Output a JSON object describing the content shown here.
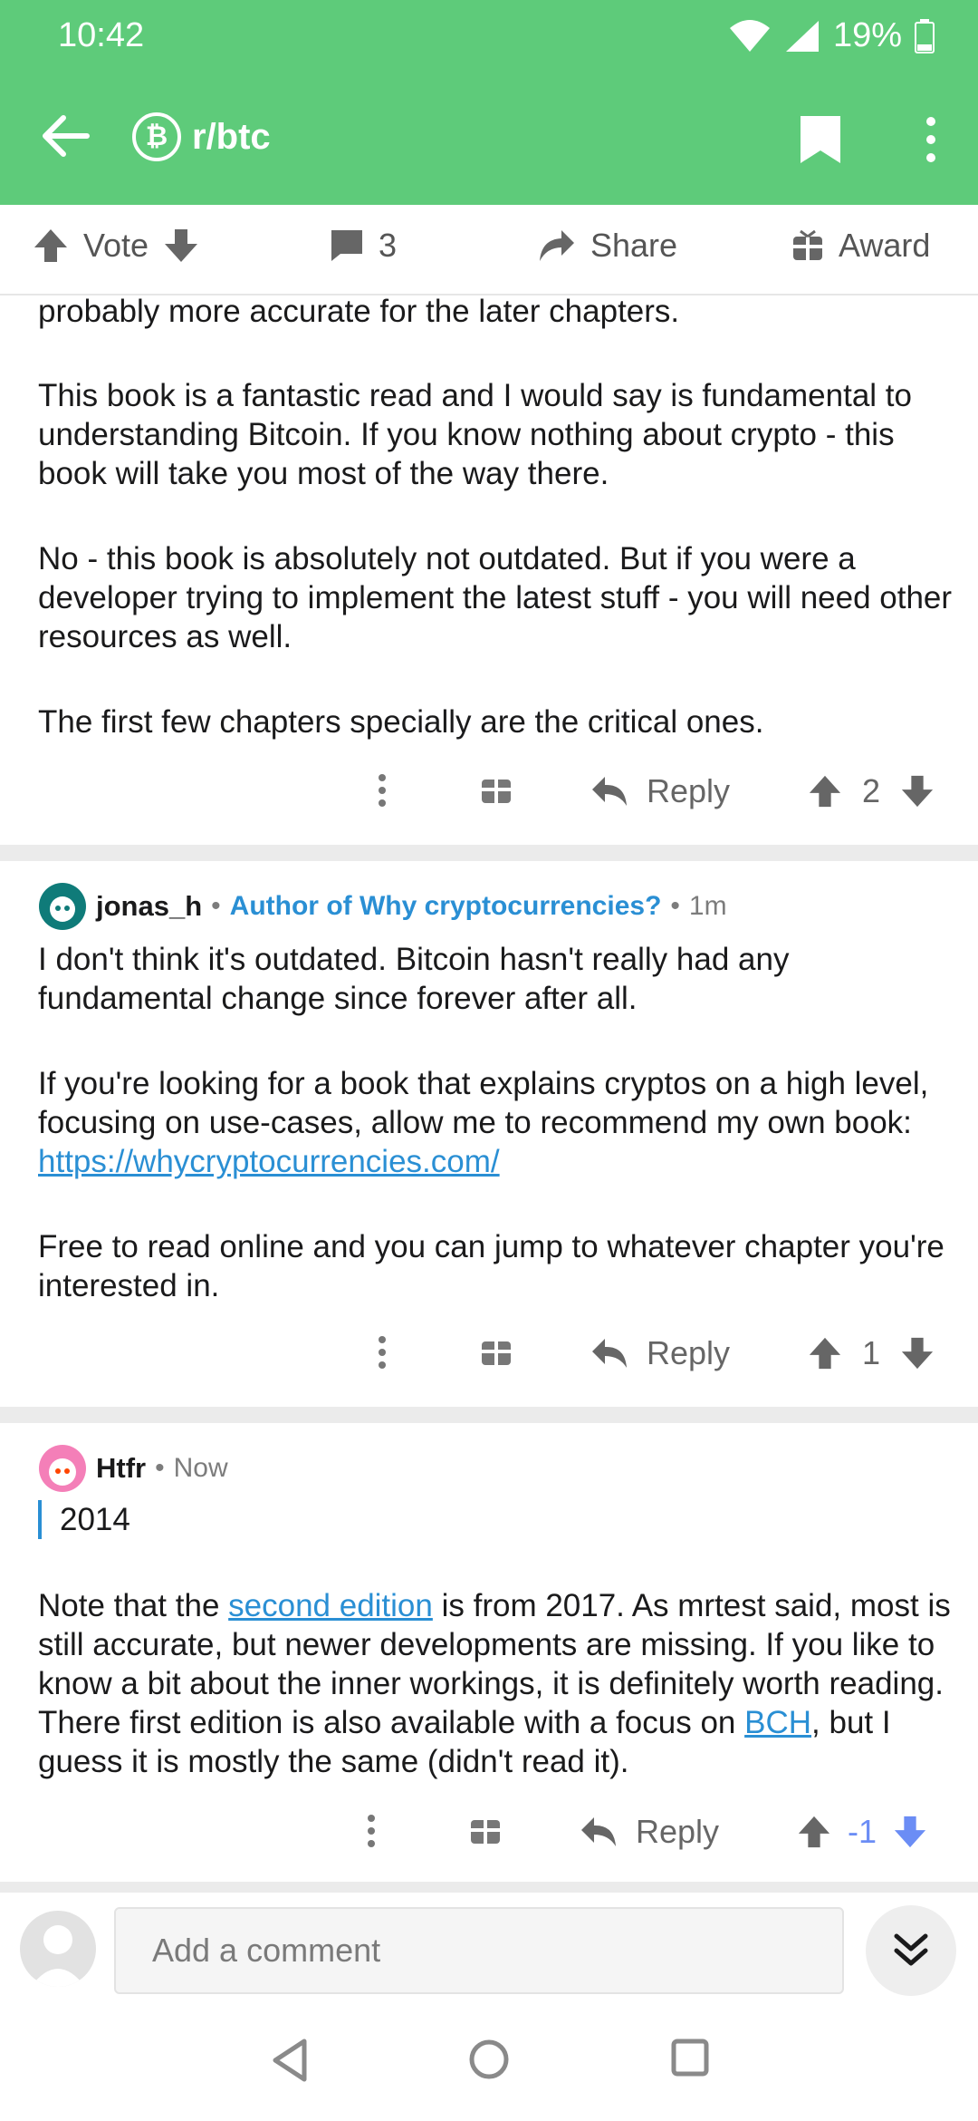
{
  "status": {
    "time": "10:42",
    "battery": "19%"
  },
  "appbar": {
    "subreddit": "r/btc",
    "sub_icon_glyph": "₿"
  },
  "post_actions": {
    "vote": "Vote",
    "comments": "3",
    "share": "Share",
    "award": "Award"
  },
  "comments": [
    {
      "paragraphs": [
        "probably more accurate for the later chapters.",
        "This book is a fantastic read and I would say is fundamental to understanding Bitcoin.  If you know nothing about crypto - this book will take you most of the way there.",
        "No - this book is absolutely not outdated.  But if you were a developer trying to implement the latest stuff - you will need other resources as well.",
        "The first few chapters specially are the critical ones."
      ],
      "reply": "Reply",
      "score": "2"
    },
    {
      "user": "jonas_h",
      "flair": "Author of Why cryptocurrencies?",
      "time": "1m",
      "p1": "I don't think it's outdated. Bitcoin hasn't really had any fundamental change since forever after all.",
      "p2_prefix": "If you're looking for a book that explains cryptos on a high level, focusing on use-cases, allow me to recommend my own book: ",
      "p2_link": "https://whycryptocurrencies.com/",
      "p3": "Free to read online and you can jump to whatever chapter you're interested in.",
      "reply": "Reply",
      "score": "1"
    },
    {
      "user": "Htfr",
      "time": "Now",
      "quote": "2014",
      "t1": "Note that the ",
      "link1": "second edition",
      "t2": " is from 2017. As mrtest said, most is still accurate, but newer developments are missing. If you like to know a bit about the inner workings, it is definitely worth reading. There first edition is also available with a focus on ",
      "link2": "BCH",
      "t3": ", but I guess it is mostly the same (didn't read it).",
      "reply": "Reply",
      "score": "-1"
    }
  ],
  "comment_bar": {
    "placeholder": "Add a comment"
  },
  "colors": {
    "header": "#5ecb7a",
    "link": "#2a8fd4",
    "downvote_active": "#6b8df5"
  }
}
